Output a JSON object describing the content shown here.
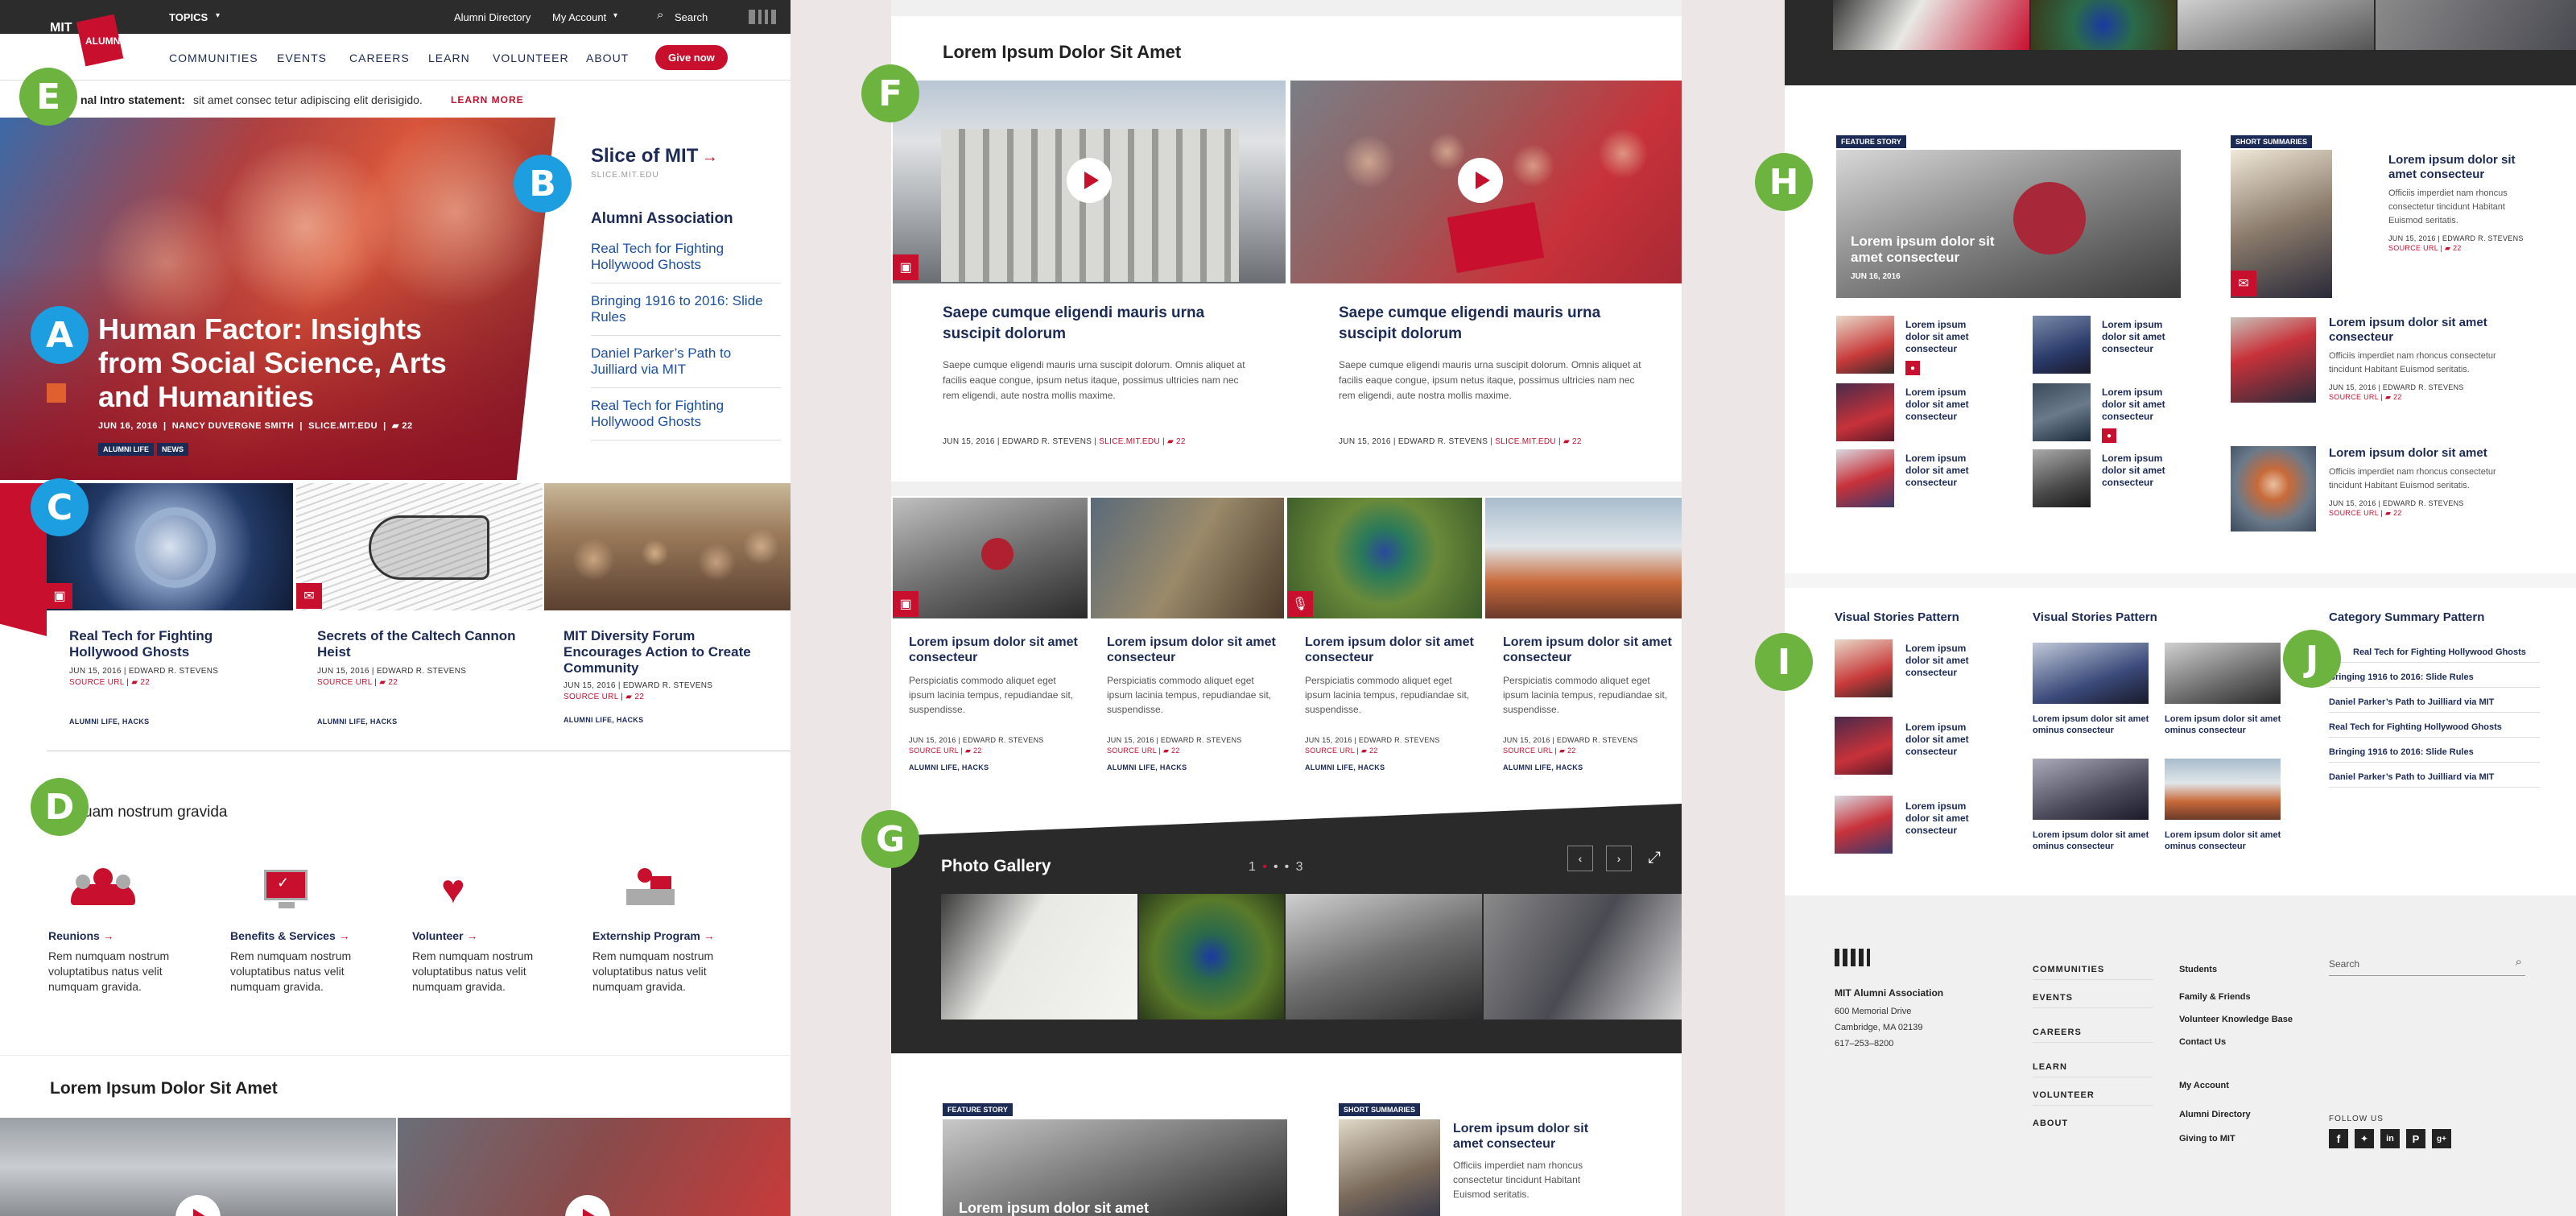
{
  "badges": {
    "a": "A",
    "b": "B",
    "c": "C",
    "d": "D",
    "e": "E",
    "f": "F",
    "g": "G",
    "h": "H",
    "i": "I",
    "j": "J"
  },
  "header": {
    "logo_top": "MIT",
    "logo_bottom": "ALUMNI",
    "topics": "TOPICS",
    "directory": "Alumni Directory",
    "account": "My Account",
    "search": "Search"
  },
  "nav": {
    "items": [
      "COMMUNITIES",
      "EVENTS",
      "CAREERS",
      "LEARN",
      "VOLUNTEER",
      "ABOUT"
    ],
    "give": "Give now"
  },
  "intro": {
    "label": "nal Intro statement:",
    "text": "sit amet consec tetur adipiscing elit derisigido.",
    "more": "LEARN MORE"
  },
  "hero": {
    "title": "Human Factor: Insights from Social Science, Arts and Humanities",
    "date": "JUN 16, 2016",
    "author": "NANCY DUVERGNE SMITH",
    "source": "SLICE.MIT.EDU",
    "comments": "22",
    "tags": [
      "ALUMNI LIFE",
      "NEWS"
    ]
  },
  "slice": {
    "title": "Slice of MIT",
    "arrow": "→",
    "url": "SLICE.MIT.EDU",
    "section": "Alumni Association",
    "links": [
      "Real Tech for Fighting Hollywood Ghosts",
      "Bringing 1916 to 2016: Slide Rules",
      "Daniel Parker’s Path to Juilliard via MIT",
      "Real Tech for Fighting Hollywood Ghosts"
    ]
  },
  "cards": [
    {
      "title": "Real Tech for Fighting Hollywood Ghosts",
      "date": "JUN 15, 2016",
      "author": "EDWARD R. STEVENS",
      "source": "SOURCE URL",
      "comments": "22",
      "tags": "ALUMNI LIFE,  HACKS"
    },
    {
      "title": "Secrets of the Caltech Cannon Heist",
      "date": "JUN 15, 2016",
      "author": "EDWARD R. STEVENS",
      "source": "SOURCE URL",
      "comments": "22",
      "tags": "ALUMNI LIFE,  HACKS"
    },
    {
      "title": "MIT Diversity Forum Encourages Action to Create Community",
      "date": "JUN 15, 2016",
      "author": "EDWARD R. STEVENS",
      "source": "SOURCE URL",
      "comments": "22",
      "tags": "ALUMNI LIFE,  HACKS"
    }
  ],
  "services": {
    "heading": "uam nostrum gravida",
    "items": [
      {
        "title": "Reunions",
        "text": "Rem numquam nostrum voluptatibus natus velit numquam gravida."
      },
      {
        "title": "Benefits & Services",
        "text": "Rem numquam nostrum voluptatibus natus velit numquam gravida."
      },
      {
        "title": "Volunteer",
        "text": "Rem numquam nostrum voluptatibus natus velit numquam gravida."
      },
      {
        "title": "Externship Program",
        "text": "Rem numquam nostrum voluptatibus natus velit numquam gravida."
      }
    ]
  },
  "lorem_heading": "Lorem Ipsum Dolor Sit Amet",
  "video_cards": [
    {
      "title": "Saepe cumque eligendi mauris urna suscipit dolorum",
      "text": "Saepe cumque eligendi mauris urna suscipit dolorum. Omnis aliquet at facilis eaque congue, ipsum netus itaque, possimus ultricies nam nec rem eligendi, aute nostra mollis maxime.",
      "date": "JUN 15, 2016",
      "author": "EDWARD R. STEVENS",
      "source": "SLICE.MIT.EDU",
      "comments": "22"
    },
    {
      "title": "Saepe cumque eligendi mauris urna suscipit dolorum",
      "text": "Saepe cumque eligendi mauris urna suscipit dolorum. Omnis aliquet at facilis eaque congue, ipsum netus itaque, possimus ultricies nam nec rem eligendi, aute nostra mollis maxime.",
      "date": "JUN 15, 2016",
      "author": "EDWARD R. STEVENS",
      "source": "SLICE.MIT.EDU",
      "comments": "22"
    }
  ],
  "small_cards": [
    {
      "title": "Lorem ipsum dolor sit amet consecteur",
      "text": "Perspiciatis commodo aliquet eget ipsum lacinia tempus, repudiandae sit, suspendisse.",
      "date": "JUN 15, 2016",
      "author": "EDWARD R. STEVENS",
      "source": "SOURCE URL",
      "comments": "22",
      "tags": "ALUMNI LIFE,  HACKS"
    },
    {
      "title": "Lorem ipsum dolor sit amet consecteur",
      "text": "Perspiciatis commodo aliquet eget ipsum lacinia tempus, repudiandae sit, suspendisse.",
      "date": "JUN 15, 2016",
      "author": "EDWARD R. STEVENS",
      "source": "SOURCE URL",
      "comments": "22",
      "tags": "ALUMNI LIFE,  HACKS"
    },
    {
      "title": "Lorem ipsum dolor sit amet consecteur",
      "text": "Perspiciatis commodo aliquet eget ipsum lacinia tempus, repudiandae sit, suspendisse.",
      "date": "JUN 15, 2016",
      "author": "EDWARD R. STEVENS",
      "source": "SOURCE URL",
      "comments": "22",
      "tags": "ALUMNI LIFE,  HACKS"
    },
    {
      "title": "Lorem ipsum dolor sit amet consecteur",
      "text": "Perspiciatis commodo aliquet eget ipsum lacinia tempus, repudiandae sit, suspendisse.",
      "date": "JUN 15, 2016",
      "author": "EDWARD R. STEVENS",
      "source": "SOURCE URL",
      "comments": "22",
      "tags": "ALUMNI LIFE,  HACKS"
    }
  ],
  "gallery": {
    "title": "Photo Gallery",
    "page_start": "1",
    "page_end": "3"
  },
  "feature": {
    "tag": "FEATURE STORY",
    "overlay": "Lorem ipsum dolor sit amet consecteur",
    "date": "JUN 16, 2016",
    "mini": [
      "Lorem ipsum dolor sit amet consecteur",
      "Lorem ipsum dolor sit amet consecteur",
      "Lorem ipsum dolor sit amet consecteur",
      "Lorem ipsum dolor sit amet consecteur",
      "Lorem ipsum dolor sit amet consecteur",
      "Lorem ipsum dolor sit amet consecteur"
    ]
  },
  "short": {
    "tag": "SHORT SUMMARIES",
    "items": [
      {
        "title": "Lorem ipsum dolor sit amet consecteur",
        "text": "Officiis imperdiet nam rhoncus consectetur tincidunt Habitant Euismod seritatis.",
        "date": "JUN 15, 2016",
        "author": "EDWARD R. STEVENS",
        "source": "SOURCE URL",
        "comments": "22"
      },
      {
        "title": "Lorem ipsum dolor sit amet consecteur",
        "text": "Officiis imperdiet nam rhoncus consectetur tincidunt Habitant Euismod seritatis.",
        "date": "JUN 15, 2016",
        "author": "EDWARD R. STEVENS",
        "source": "SOURCE URL",
        "comments": "22"
      },
      {
        "title": "Lorem ipsum dolor sit amet",
        "text": "Officiis imperdiet nam rhoncus consectetur tincidunt Habitant Euismod seritatis.",
        "date": "JUN 15, 2016",
        "author": "EDWARD R. STEVENS",
        "source": "SOURCE URL",
        "comments": "22"
      }
    ]
  },
  "patterns": {
    "visual1": "Visual Stories Pattern",
    "visual2": "Visual Stories Pattern",
    "category": "Category Summary Pattern",
    "v1_items": [
      "Lorem ipsum dolor sit amet consecteur",
      "Lorem ipsum dolor sit amet consecteur",
      "Lorem ipsum dolor sit amet consecteur"
    ],
    "v2_items": [
      "Lorem ipsum dolor sit amet ominus consecteur",
      "Lorem ipsum dolor sit amet ominus consecteur",
      "Lorem ipsum dolor sit amet ominus consecteur",
      "Lorem ipsum dolor sit amet ominus consecteur"
    ],
    "cat_items": [
      "Real Tech for Fighting Hollywood Ghosts",
      "Bringing 1916 to 2016: Slide Rules",
      "Daniel Parker’s Path to Juilliard via MIT",
      "Real Tech for Fighting Hollywood Ghosts",
      "Bringing 1916 to 2016: Slide Rules",
      "Daniel Parker’s Path to Juilliard via MIT"
    ]
  },
  "footer": {
    "org": "MIT Alumni Association",
    "addr1": "600 Memorial Drive",
    "addr2": "Cambridge, MA 02139",
    "phone": "617–253–8200",
    "nav": [
      "COMMUNITIES",
      "EVENTS",
      "CAREERS",
      "LEARN",
      "VOLUNTEER",
      "ABOUT"
    ],
    "links1": [
      "Students",
      "Family & Friends",
      "Volunteer Knowledge Base",
      "Contact Us"
    ],
    "links2": [
      "My Account",
      "Alumni Directory",
      "Giving to MIT"
    ],
    "search": "Search",
    "follow": "FOLLOW US"
  },
  "colors": {
    "navy": "#1c2a56",
    "red": "#c8102e",
    "green": "#6cb33f",
    "blue": "#1c9ee0"
  }
}
